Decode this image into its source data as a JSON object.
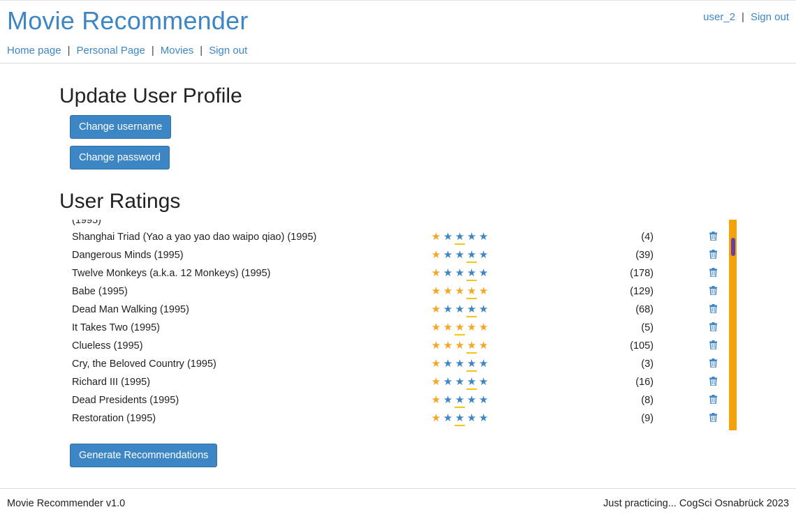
{
  "header": {
    "brand": "Movie Recommender",
    "nav": [
      "Home page",
      "Personal Page",
      "Movies",
      "Sign out"
    ],
    "nav_separator": "|",
    "user": "user_2",
    "user_sign_out": "Sign out"
  },
  "profile": {
    "title": "Update User Profile",
    "change_username": "Change username",
    "change_password": "Change password"
  },
  "ratings": {
    "title": "User Ratings",
    "partial_top": "(1995)",
    "rows": [
      {
        "title": "Shanghai Triad (Yao a yao yao dao waipo qiao) (1995)",
        "count": "(4)",
        "stars_on": 1,
        "underline": 3
      },
      {
        "title": "Dangerous Minds (1995)",
        "count": "(39)",
        "stars_on": 1,
        "underline": 4
      },
      {
        "title": "Twelve Monkeys (a.k.a. 12 Monkeys) (1995)",
        "count": "(178)",
        "stars_on": 1,
        "underline": 4
      },
      {
        "title": "Babe (1995)",
        "count": "(129)",
        "stars_on": 5,
        "underline": 4
      },
      {
        "title": "Dead Man Walking (1995)",
        "count": "(68)",
        "stars_on": 1,
        "underline": 4
      },
      {
        "title": "It Takes Two (1995)",
        "count": "(5)",
        "stars_on": 5,
        "underline": 3
      },
      {
        "title": "Clueless (1995)",
        "count": "(105)",
        "stars_on": 5,
        "underline": 4
      },
      {
        "title": "Cry, the Beloved Country (1995)",
        "count": "(3)",
        "stars_on": 1,
        "underline": 4
      },
      {
        "title": "Richard III (1995)",
        "count": "(16)",
        "stars_on": 1,
        "underline": 4
      },
      {
        "title": "Dead Presidents (1995)",
        "count": "(8)",
        "stars_on": 1,
        "underline": 3
      },
      {
        "title": "Restoration (1995)",
        "count": "(9)",
        "stars_on": 1,
        "underline": 3
      }
    ],
    "generate": "Generate Recommendations",
    "colors": {
      "star_on": "#f5a623",
      "star_off": "#3d86c6",
      "scrollbar": "#f4a20c",
      "thumb": "#6b3fa0"
    }
  },
  "icons": {
    "star": "star-icon",
    "delete": "trash-icon"
  },
  "footer": {
    "left": "Movie Recommender v1.0",
    "right": "Just practicing... CogSci Osnabrück 2023"
  },
  "theme": {
    "accent": "#3d86c6"
  }
}
